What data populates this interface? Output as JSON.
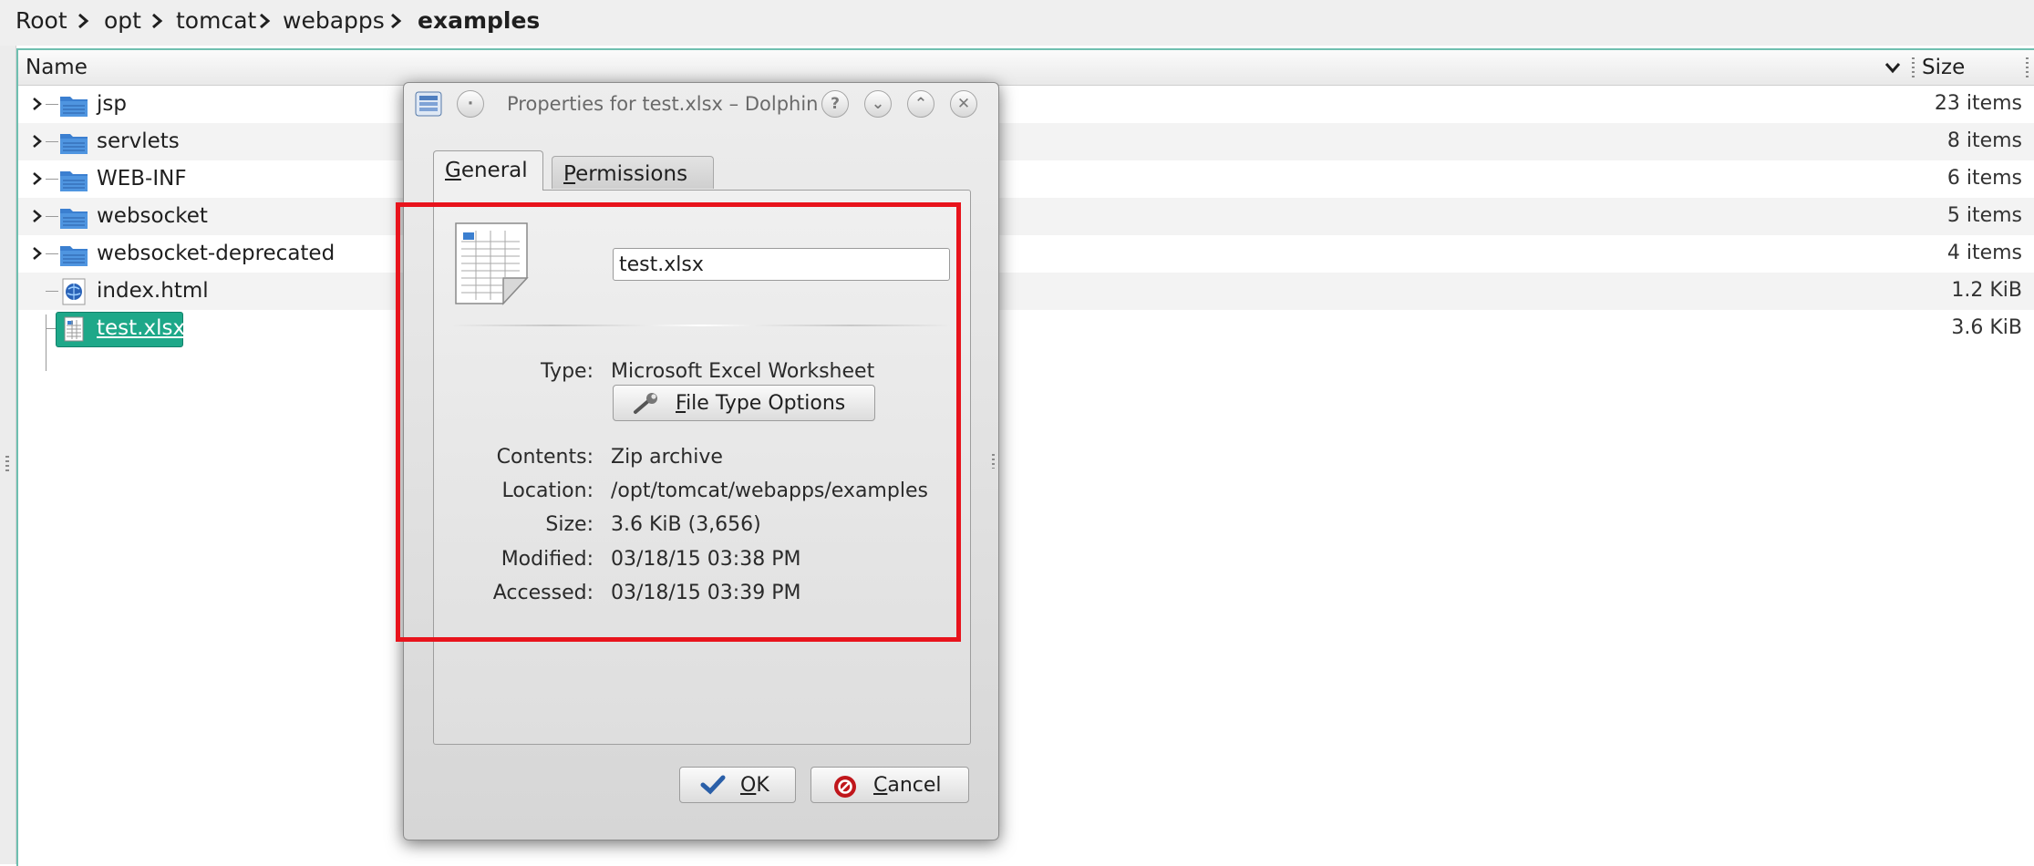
{
  "breadcrumb": [
    {
      "label": "Root"
    },
    {
      "label": "opt"
    },
    {
      "label": "tomcat"
    },
    {
      "label": "webapps"
    },
    {
      "label": "examples",
      "current": true
    }
  ],
  "columns": {
    "name": "Name",
    "size": "Size"
  },
  "files": [
    {
      "name": "jsp",
      "size": "23 items",
      "type": "folder"
    },
    {
      "name": "servlets",
      "size": "8 items",
      "type": "folder"
    },
    {
      "name": "WEB-INF",
      "size": "6 items",
      "type": "folder"
    },
    {
      "name": "websocket",
      "size": "5 items",
      "type": "folder"
    },
    {
      "name": "websocket-deprecated",
      "size": "4 items",
      "type": "folder"
    },
    {
      "name": "index.html",
      "size": "1.2 KiB",
      "type": "html"
    },
    {
      "name": "test.xlsx",
      "size": "3.6 KiB",
      "type": "spreadsheet",
      "selected": true
    }
  ],
  "dialog": {
    "title": "Properties for test.xlsx – Dolphin",
    "titlebar_buttons": {
      "help": "?",
      "minimize": "⌄",
      "maximize": "⌃",
      "close": "✕"
    },
    "tabs": [
      {
        "mnemonic": "G",
        "rest": "eneral",
        "active": true
      },
      {
        "mnemonic": "P",
        "rest": "ermissions",
        "active": false
      }
    ],
    "filename_value": "test.xlsx",
    "properties": [
      {
        "label": "Type:",
        "value": "Microsoft Excel Worksheet"
      },
      {
        "label": "Contents:",
        "value": "Zip archive"
      },
      {
        "label": "Location:",
        "value": "/opt/tomcat/webapps/examples"
      },
      {
        "label": "Size:",
        "value": "3.6 KiB (3,656)"
      },
      {
        "label": "Modified:",
        "value": "03/18/15 03:38 PM"
      },
      {
        "label": "Accessed:",
        "value": "03/18/15 03:39 PM"
      }
    ],
    "file_type_button": {
      "mnemonic": "F",
      "rest": "ile Type Options"
    },
    "ok_button": {
      "mnemonic": "O",
      "rest": "K"
    },
    "cancel_button": {
      "mnemonic": "C",
      "rest": "ancel"
    }
  },
  "colors": {
    "selection": "#1ea889",
    "view_border": "#6fbfb0",
    "highlight_box": "#e8131c",
    "folder_blue": "#3b7fd0",
    "cancel_red": "#c0161b",
    "ok_blue": "#2a5fa8"
  },
  "icons": {
    "folder": "folder-icon",
    "html": "html-file-icon",
    "spreadsheet": "spreadsheet-icon",
    "expander": "chevron-right-icon"
  }
}
